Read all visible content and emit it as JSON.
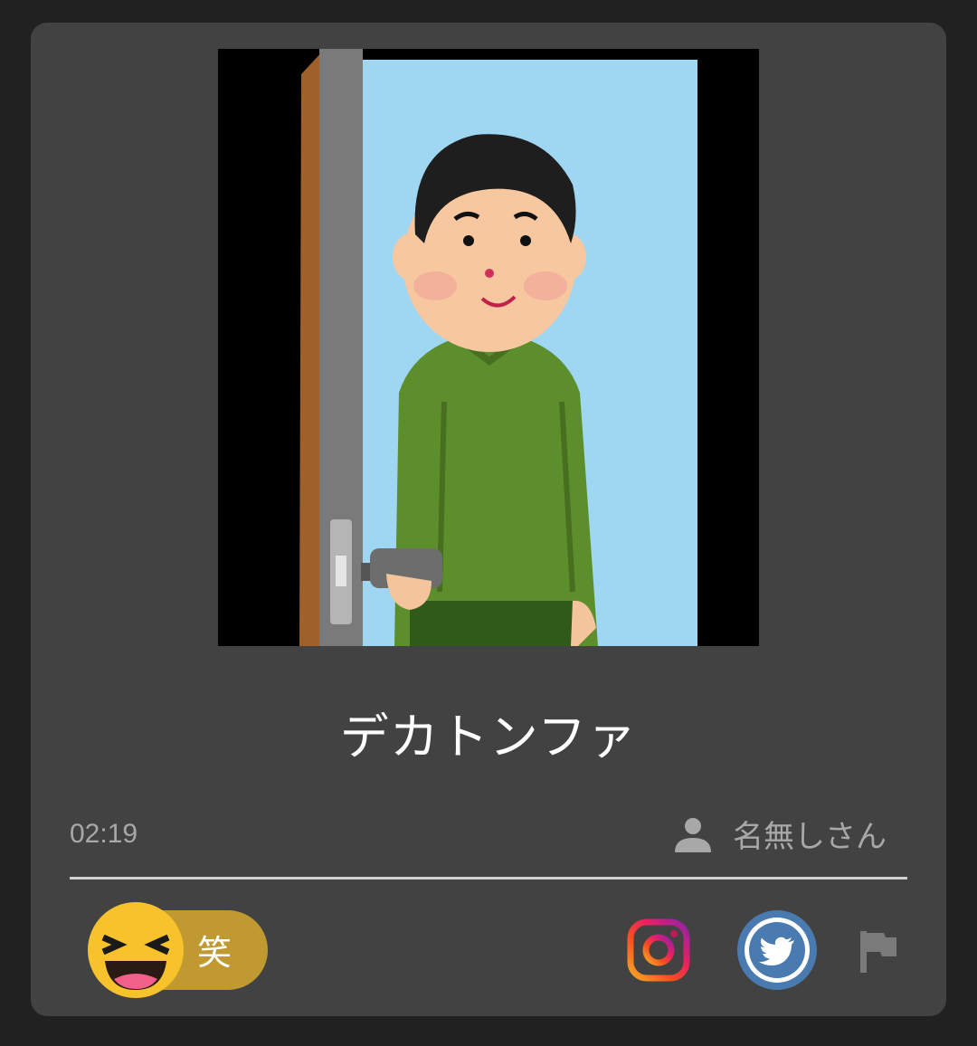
{
  "post": {
    "title": "デカトンファ",
    "time": "02:19",
    "author": "名無しさん"
  },
  "reaction": {
    "label": "笑",
    "icon": "laughing-face-icon"
  },
  "actions": {
    "instagram_icon": "instagram-icon",
    "twitter_icon": "twitter-icon",
    "report_icon": "flag-icon"
  },
  "colors": {
    "page_background": "#212121",
    "card_background": "#424242",
    "reaction_pill": "#c09a30",
    "twitter_blue": "#4a7bb0"
  }
}
